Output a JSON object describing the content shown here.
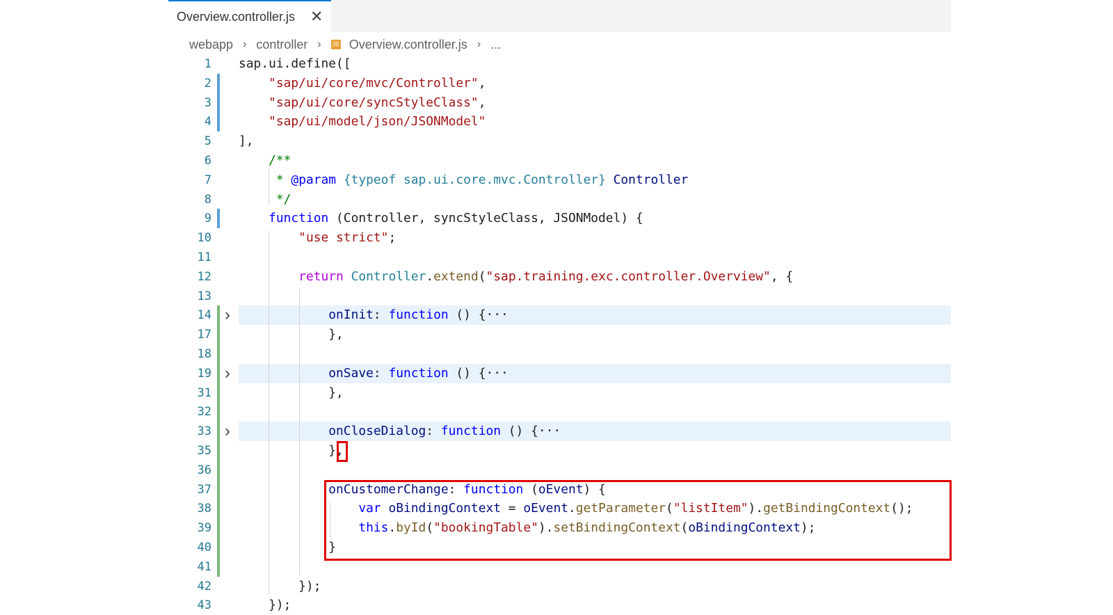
{
  "tab": {
    "label": "Overview.controller.js",
    "close_glyph": "✕"
  },
  "breadcrumb": {
    "items": [
      "webapp",
      "controller",
      "Overview.controller.js",
      "..."
    ],
    "file_icon": "JS"
  },
  "lines": [
    {
      "n": "1",
      "t": [
        [
          "",
          "sap.ui.define(["
        ]
      ]
    },
    {
      "n": "2",
      "t": [
        [
          "",
          "    "
        ],
        [
          "str",
          "\"sap/ui/core/mvc/Controller\""
        ],
        [
          "",
          ","
        ]
      ]
    },
    {
      "n": "3",
      "t": [
        [
          "",
          "    "
        ],
        [
          "str",
          "\"sap/ui/core/syncStyleClass\""
        ],
        [
          "",
          ","
        ]
      ]
    },
    {
      "n": "4",
      "t": [
        [
          "",
          "    "
        ],
        [
          "str",
          "\"sap/ui/model/json/JSONModel\""
        ]
      ]
    },
    {
      "n": "5",
      "t": [
        [
          "",
          "],"
        ]
      ]
    },
    {
      "n": "6",
      "t": [
        [
          "",
          "    "
        ],
        [
          "cm",
          "/**"
        ]
      ]
    },
    {
      "n": "7",
      "t": [
        [
          "",
          "    "
        ],
        [
          "cm",
          " * "
        ],
        [
          "jsd",
          "@param"
        ],
        [
          "cm",
          " "
        ],
        [
          "jt",
          "{typeof sap.ui.core.mvc.Controller}"
        ],
        [
          "cm",
          " "
        ],
        [
          "prop",
          "Controller"
        ]
      ]
    },
    {
      "n": "8",
      "t": [
        [
          "",
          "    "
        ],
        [
          "cm",
          " */"
        ]
      ]
    },
    {
      "n": "9",
      "t": [
        [
          "",
          "    "
        ],
        [
          "kw",
          "function"
        ],
        [
          "",
          " (Controller, syncStyleClass, JSONModel) {"
        ]
      ]
    },
    {
      "n": "10",
      "t": [
        [
          "",
          "        "
        ],
        [
          "str",
          "\"use strict\""
        ],
        [
          "",
          ";"
        ]
      ]
    },
    {
      "n": "11",
      "t": [
        [
          "",
          ""
        ]
      ]
    },
    {
      "n": "12",
      "t": [
        [
          "",
          "        "
        ],
        [
          "ctl",
          "return"
        ],
        [
          "",
          " "
        ],
        [
          "typ",
          "Controller"
        ],
        [
          "",
          "."
        ],
        [
          "fn",
          "extend"
        ],
        [
          "",
          "("
        ],
        [
          "str",
          "\"sap.training.exc.controller.Overview\""
        ],
        [
          "",
          ", {"
        ]
      ]
    },
    {
      "n": "13",
      "t": [
        [
          "",
          ""
        ]
      ]
    },
    {
      "n": "14",
      "t": [
        [
          "",
          "            "
        ],
        [
          "prop",
          "onInit"
        ],
        [
          "",
          ": "
        ],
        [
          "kw",
          "function"
        ],
        [
          "",
          " () {"
        ],
        [
          "",
          "···"
        ]
      ]
    },
    {
      "n": "17",
      "t": [
        [
          "",
          "            },"
        ]
      ]
    },
    {
      "n": "18",
      "t": [
        [
          "",
          ""
        ]
      ]
    },
    {
      "n": "19",
      "t": [
        [
          "",
          "            "
        ],
        [
          "prop",
          "onSave"
        ],
        [
          "",
          ": "
        ],
        [
          "kw",
          "function"
        ],
        [
          "",
          " () {"
        ],
        [
          "",
          "···"
        ]
      ]
    },
    {
      "n": "31",
      "t": [
        [
          "",
          "            },"
        ]
      ]
    },
    {
      "n": "32",
      "t": [
        [
          "",
          ""
        ]
      ]
    },
    {
      "n": "33",
      "t": [
        [
          "",
          "            "
        ],
        [
          "prop",
          "onCloseDialog"
        ],
        [
          "",
          ": "
        ],
        [
          "kw",
          "function"
        ],
        [
          "",
          " () {"
        ],
        [
          "",
          "···"
        ]
      ]
    },
    {
      "n": "35",
      "t": [
        [
          "",
          "            },"
        ]
      ]
    },
    {
      "n": "36",
      "t": [
        [
          "",
          ""
        ]
      ]
    },
    {
      "n": "37",
      "t": [
        [
          "",
          "            "
        ],
        [
          "prop",
          "onCustomerChange"
        ],
        [
          "",
          ": "
        ],
        [
          "kw",
          "function"
        ],
        [
          "",
          " ("
        ],
        [
          "prop",
          "oEvent"
        ],
        [
          "",
          ") {"
        ]
      ]
    },
    {
      "n": "38",
      "t": [
        [
          "",
          "                "
        ],
        [
          "kw",
          "var"
        ],
        [
          "",
          " "
        ],
        [
          "prop",
          "oBindingContext"
        ],
        [
          "",
          " = "
        ],
        [
          "prop",
          "oEvent"
        ],
        [
          "",
          "."
        ],
        [
          "fn",
          "getParameter"
        ],
        [
          "",
          "("
        ],
        [
          "str",
          "\"listItem\""
        ],
        [
          "",
          ")."
        ],
        [
          "fn",
          "getBindingContext"
        ],
        [
          "",
          "();"
        ]
      ]
    },
    {
      "n": "39",
      "t": [
        [
          "",
          "                "
        ],
        [
          "kw",
          "this"
        ],
        [
          "",
          "."
        ],
        [
          "fn",
          "byId"
        ],
        [
          "",
          "("
        ],
        [
          "str",
          "\"bookingTable\""
        ],
        [
          "",
          ")."
        ],
        [
          "fn",
          "setBindingContext"
        ],
        [
          "",
          "("
        ],
        [
          "prop",
          "oBindingContext"
        ],
        [
          "",
          ");"
        ]
      ]
    },
    {
      "n": "40",
      "t": [
        [
          "",
          "            }"
        ]
      ]
    },
    {
      "n": "41",
      "t": [
        [
          "",
          ""
        ]
      ]
    },
    {
      "n": "42",
      "t": [
        [
          "",
          "        });"
        ]
      ]
    },
    {
      "n": "43",
      "t": [
        [
          "",
          "    });"
        ]
      ]
    }
  ],
  "colors": {
    "accent": "#0078d4",
    "highlight": "#e8f2fc",
    "annotation_red": "#e00000",
    "gutter_added": "#7cb87c",
    "gutter_modified": "#5aa0d6"
  }
}
